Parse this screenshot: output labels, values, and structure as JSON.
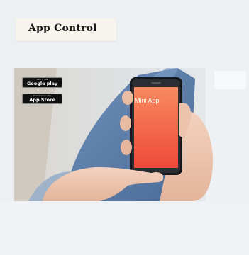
{
  "header": {
    "title": "App Control"
  },
  "banner": {
    "badges": [
      {
        "small_text": "GET IT ON",
        "label": "Google play"
      },
      {
        "small_text": "Download on the",
        "label": "App Store"
      }
    ],
    "phone_screen_text": "Mini App"
  },
  "colors": {
    "page_background": "#edf0f3",
    "title_box": "#f7f4ee",
    "phone_screen_top": "#f68a5e",
    "phone_screen_bottom": "#ee4a3a",
    "shirt": "#5b7fab"
  }
}
